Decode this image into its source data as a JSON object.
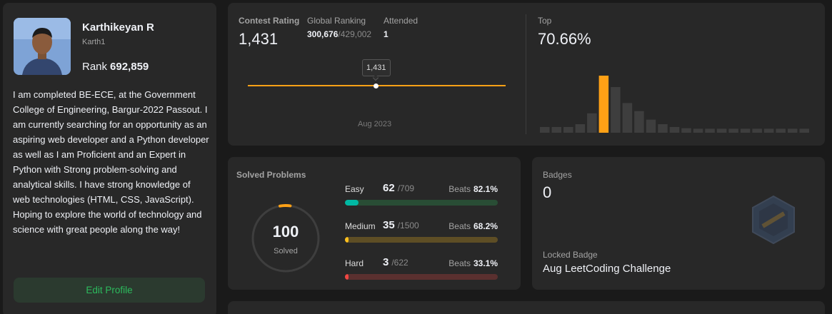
{
  "profile": {
    "name": "Karthikeyan R",
    "username": "Karth1",
    "rank_label": "Rank",
    "rank_value": "692,859",
    "bio": "I am completed BE-ECE, at the Government College of Engineering, Bargur-2022 Passout. I am currently searching for an opportunity as an aspiring web developer and a Python developer as well as I am Proficient and an Expert in Python with Strong problem-solving and analytical skills. I have strong knowledge of web technologies (HTML, CSS, JavaScript). Hoping to explore the world of technology and science with great people along the way!",
    "edit_button": "Edit Profile"
  },
  "contest": {
    "rating_label": "Contest Rating",
    "rating_value": "1,431",
    "global_label": "Global Ranking",
    "global_value": "300,676",
    "global_total": "/429,002",
    "attended_label": "Attended",
    "attended_value": "1",
    "tooltip": "1,431",
    "date_label": "Aug 2023",
    "top_label": "Top",
    "top_value": "70.66%"
  },
  "chart_data": {
    "type": "bar",
    "title": "",
    "values": [
      0.1,
      0.1,
      0.1,
      0.15,
      0.34,
      1.0,
      0.8,
      0.52,
      0.38,
      0.23,
      0.15,
      0.1,
      0.08,
      0.07,
      0.07,
      0.07,
      0.07,
      0.07,
      0.07,
      0.07,
      0.07,
      0.07,
      0.07
    ],
    "highlight_index": 5,
    "colors": {
      "bar": "#3e3e3e",
      "highlight": "#ffa116"
    }
  },
  "solved": {
    "label": "Solved Problems",
    "count": "100",
    "count_label": "Solved",
    "ring_fraction": 0.05,
    "difficulties": [
      {
        "name": "Easy",
        "solved": "62",
        "total": "/709",
        "beats_label": "Beats",
        "beats": "82.1%",
        "fraction": 0.087,
        "color": "#00b8a3",
        "track": "#294d35"
      },
      {
        "name": "Medium",
        "solved": "35",
        "total": "/1500",
        "beats_label": "Beats",
        "beats": "68.2%",
        "fraction": 0.023,
        "color": "#ffc01e",
        "track": "#5e4e25"
      },
      {
        "name": "Hard",
        "solved": "3",
        "total": "/622",
        "beats_label": "Beats",
        "beats": "33.1%",
        "fraction": 0.005,
        "color": "#ef4743",
        "track": "#5a302f"
      }
    ]
  },
  "badges": {
    "label": "Badges",
    "count": "0",
    "locked_label": "Locked Badge",
    "locked_name": "Aug LeetCoding Challenge"
  }
}
